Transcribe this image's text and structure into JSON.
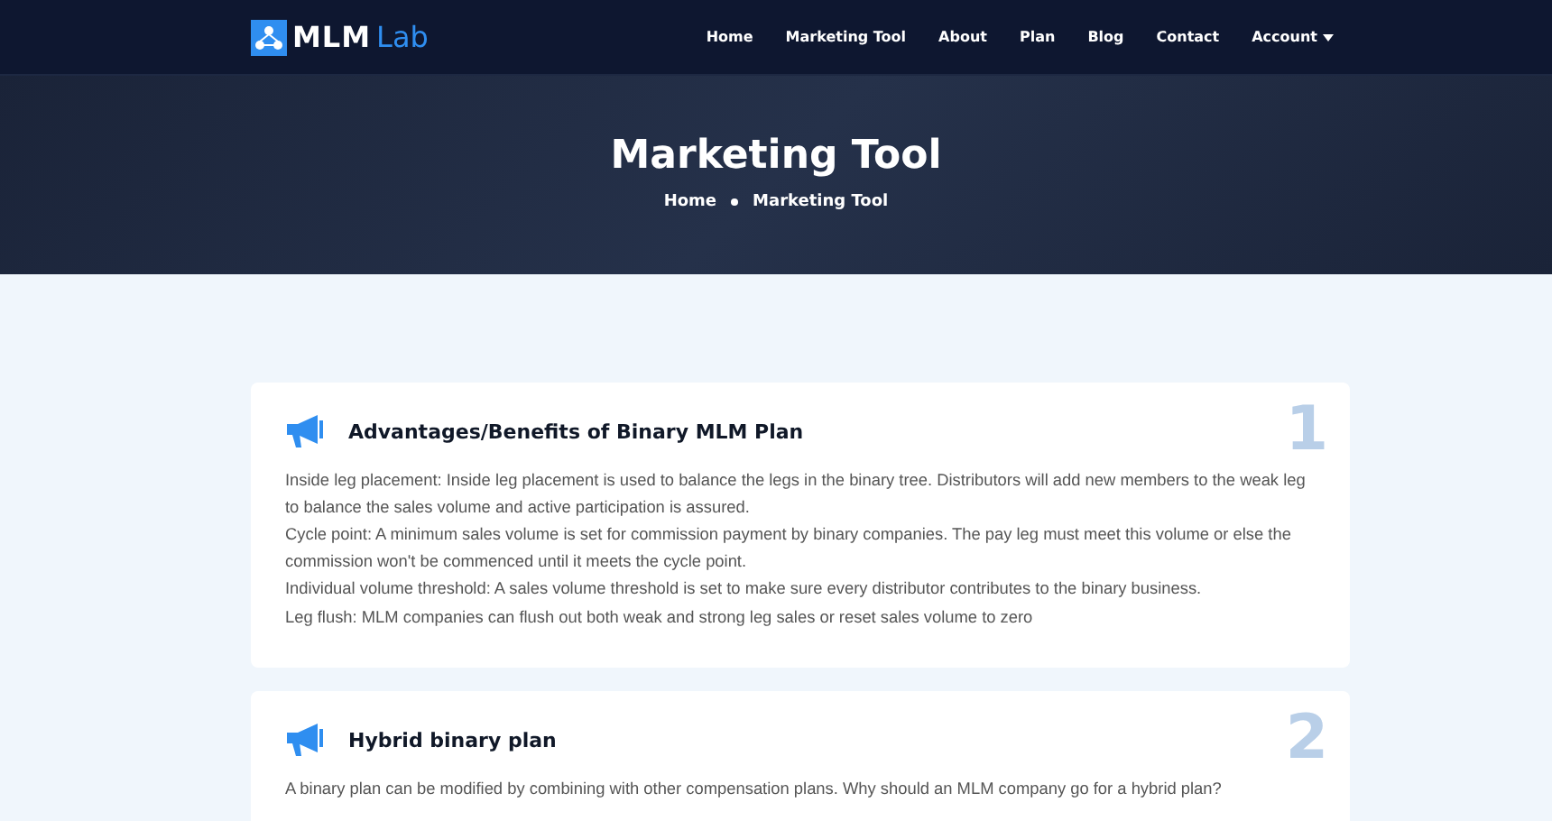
{
  "header": {
    "logo": {
      "part_1": "MLM",
      "part_2": "Lab"
    },
    "nav": [
      {
        "label": "Home",
        "kind": "link"
      },
      {
        "label": "Marketing Tool",
        "kind": "link"
      },
      {
        "label": "About",
        "kind": "link"
      },
      {
        "label": "Plan",
        "kind": "link"
      },
      {
        "label": "Blog",
        "kind": "link"
      },
      {
        "label": "Contact",
        "kind": "link"
      },
      {
        "label": "Account",
        "kind": "dropdown"
      }
    ]
  },
  "hero": {
    "title": "Marketing Tool",
    "breadcrumb": [
      "Home",
      "Marketing Tool"
    ]
  },
  "cards": [
    {
      "number": "1",
      "title": "Advantages/Benefits of Binary MLM Plan",
      "paragraphs": [
        "Inside leg placement: Inside leg placement is used to balance the legs in the binary tree. Distributors will add new members to the weak leg to balance the sales volume and active participation is assured.",
        "Cycle point: A minimum sales volume is set for commission payment by binary companies. The pay leg must meet this volume or else the commission won't be commenced until it meets the cycle point.",
        "Individual volume threshold: A sales volume threshold is set to make sure every distributor contributes to the binary business.",
        "Leg flush: MLM companies can flush out both weak and strong leg sales or reset sales volume to zero"
      ]
    },
    {
      "number": "2",
      "title": "Hybrid binary plan",
      "paragraphs": [
        "A binary plan can be modified by combining with other compensation plans. Why should an MLM company go for a hybrid plan?"
      ]
    }
  ]
}
